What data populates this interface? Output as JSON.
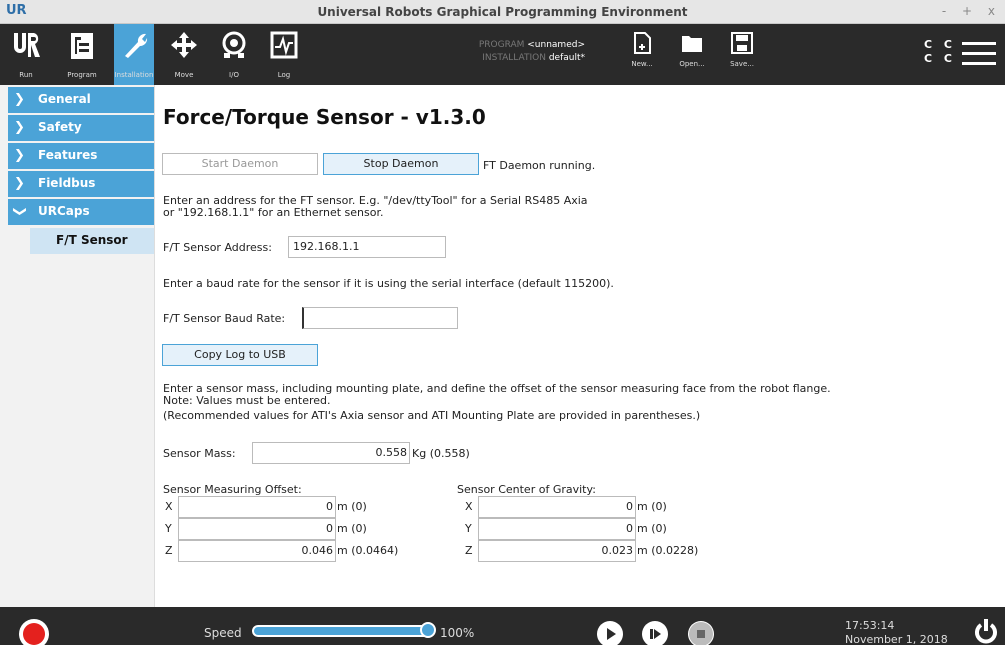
{
  "window": {
    "title": "Universal Robots Graphical Programming Environment",
    "logo": "UR",
    "controls": "- + x"
  },
  "nav": {
    "tabs": [
      {
        "label": "Run",
        "icon": "ur-logo-icon"
      },
      {
        "label": "Program",
        "icon": "program-icon"
      },
      {
        "label": "Installation",
        "icon": "installation-icon",
        "active": true
      },
      {
        "label": "Move",
        "icon": "move-icon"
      },
      {
        "label": "I/O",
        "icon": "io-icon"
      },
      {
        "label": "Log",
        "icon": "log-icon"
      }
    ],
    "program_key": "PROGRAM",
    "program_value": "<unnamed>",
    "installation_key": "INSTALLATION",
    "installation_value": "default*",
    "file": [
      {
        "label": "New...",
        "icon": "new-file-icon"
      },
      {
        "label": "Open...",
        "icon": "open-folder-icon"
      },
      {
        "label": "Save...",
        "icon": "save-icon"
      }
    ],
    "cc_top": "C C",
    "cc_bottom": "C C"
  },
  "sidebar": {
    "items": [
      {
        "label": "General",
        "expanded": false
      },
      {
        "label": "Safety",
        "expanded": false
      },
      {
        "label": "Features",
        "expanded": false
      },
      {
        "label": "Fieldbus",
        "expanded": false
      },
      {
        "label": "URCaps",
        "expanded": true
      }
    ],
    "sub": {
      "label": "F/T Sensor",
      "selected": true
    }
  },
  "main": {
    "title": "Force/Torque Sensor - v1.3.0",
    "start_daemon": "Start Daemon",
    "stop_daemon": "Stop Daemon",
    "daemon_status": "FT Daemon running.",
    "address_help_1": "Enter an address for the FT sensor. E.g. \"/dev/ttyTool\" for a Serial RS485 Axia",
    "address_help_2": "or \"192.168.1.1\" for an Ethernet sensor.",
    "address_label": "F/T Sensor Address:",
    "address_value": "192.168.1.1",
    "baud_help": "Enter a baud rate for the sensor if it is using the serial interface (default 115200).",
    "baud_label": "F/T Sensor Baud Rate:",
    "baud_value": "",
    "copy_log": "Copy Log to USB",
    "mass_help_1": "Enter a sensor mass, including mounting plate, and define the offset of the sensor measuring face from the robot flange.",
    "mass_help_2": "Note: Values must be entered.",
    "mass_help_3": "(Recommended values for ATI's Axia sensor and ATI Mounting Plate are provided in parentheses.)",
    "mass_label": "Sensor Mass:",
    "mass_value": "0.558",
    "mass_unit": "Kg (0.558)",
    "offset": {
      "title": "Sensor Measuring Offset:",
      "rows": [
        {
          "axis": "X",
          "value": "0",
          "unit": "m (0)"
        },
        {
          "axis": "Y",
          "value": "0",
          "unit": "m (0)"
        },
        {
          "axis": "Z",
          "value": "0.046",
          "unit": "m (0.0464)"
        }
      ]
    },
    "cog": {
      "title": "Sensor Center of Gravity:",
      "rows": [
        {
          "axis": "X",
          "value": "0",
          "unit": "m (0)"
        },
        {
          "axis": "Y",
          "value": "0",
          "unit": "m (0)"
        },
        {
          "axis": "Z",
          "value": "0.023",
          "unit": "m (0.0228)"
        }
      ]
    }
  },
  "bottom": {
    "speed_label": "Speed",
    "speed_value": "100%",
    "speed_fraction": 1.0,
    "time": "17:53:14",
    "date": "November 1, 2018"
  },
  "colors": {
    "accent": "#4ba3d7",
    "dark": "#2a2a2a",
    "stop_red": "#e4211e"
  }
}
